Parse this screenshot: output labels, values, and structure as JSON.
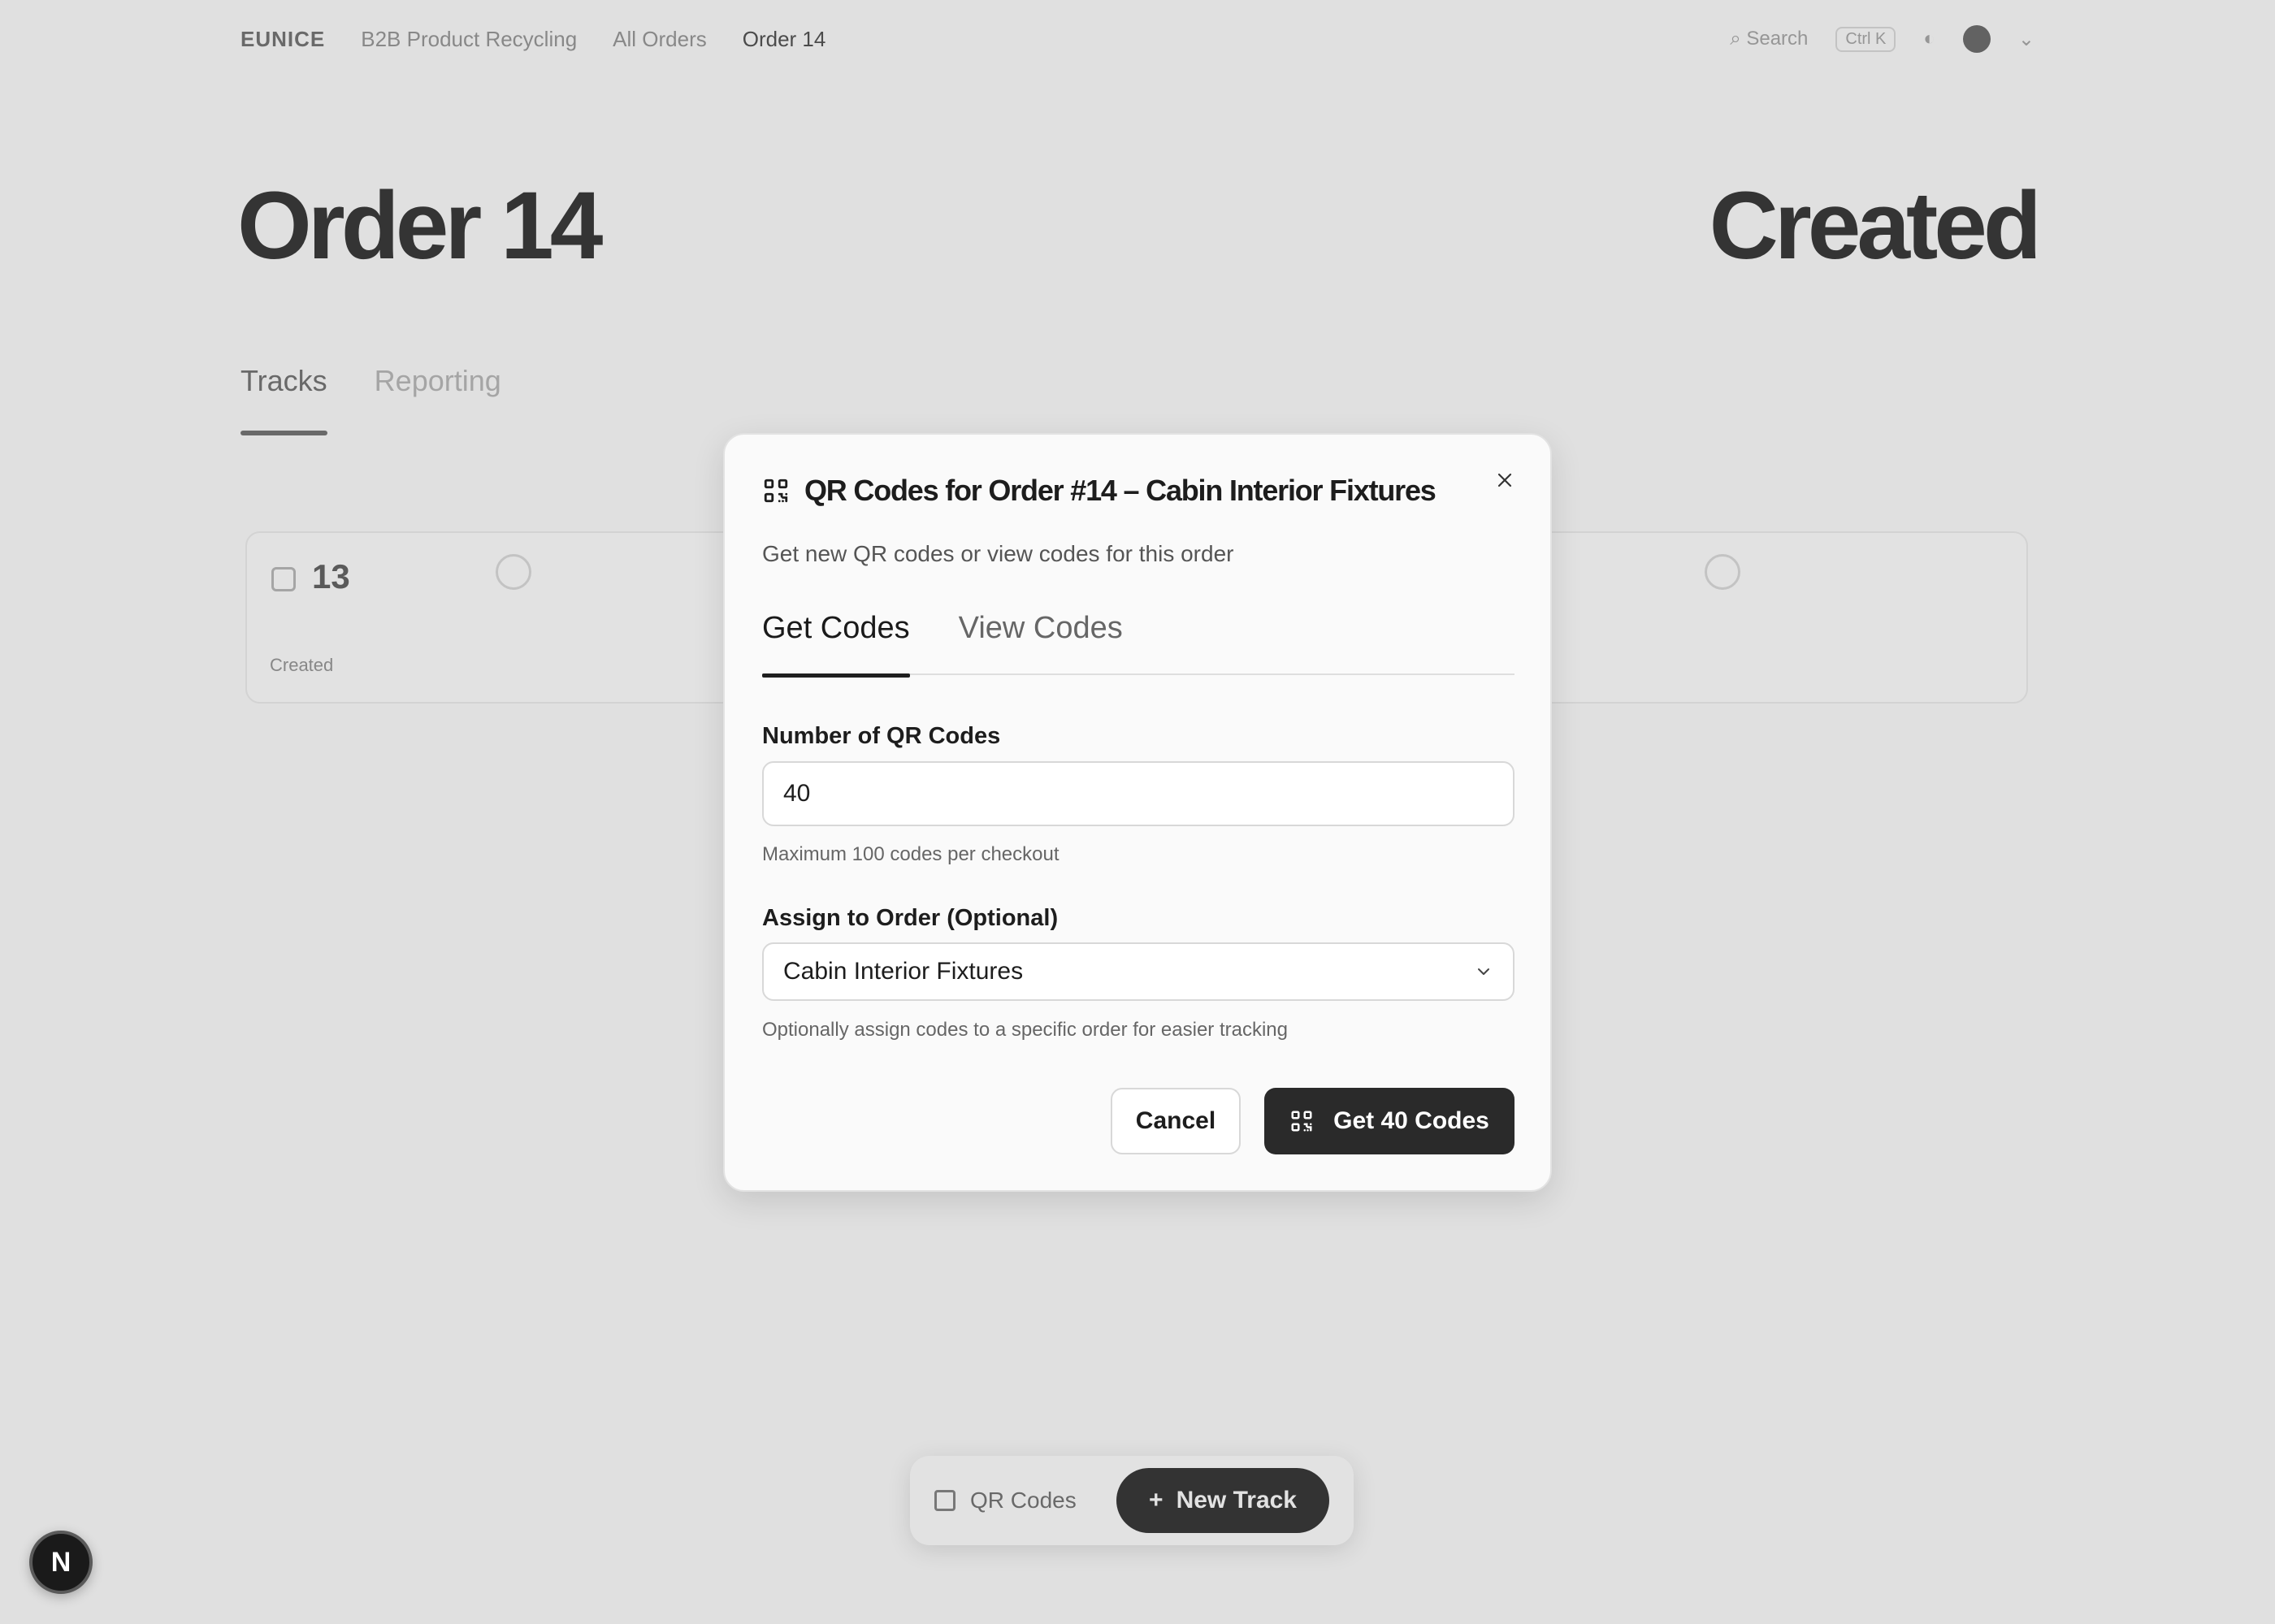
{
  "background": {
    "logo": "EUNICE",
    "breadcrumbs": [
      "B2B Product Recycling",
      "All Orders",
      "Order 14"
    ],
    "search_label": "Search",
    "search_shortcut": "Ctrl K",
    "page_title": "Order 14",
    "order_status": "Created",
    "tabs": [
      "Tracks",
      "Reporting"
    ],
    "stats": {
      "count": "13",
      "label": "Created"
    },
    "bottom_bar": {
      "qr_label": "QR Codes",
      "new_label": "New Track"
    }
  },
  "dialog": {
    "title": "QR Codes for Order #14 – Cabin Interior Fixtures",
    "description": "Get new QR codes or view codes for this order",
    "tabs": [
      {
        "label": "Get Codes",
        "active": true
      },
      {
        "label": "View Codes",
        "active": false
      }
    ],
    "count_field": {
      "label": "Number of QR Codes",
      "value": "40",
      "hint": "Maximum 100 codes per checkout"
    },
    "order_field": {
      "label": "Assign to Order (Optional)",
      "selected": "Cabin Interior Fixtures",
      "hint": "Optionally assign codes to a specific order for easier tracking"
    },
    "cancel_label": "Cancel",
    "submit_label": "Get 40 Codes"
  },
  "dev_badge": "N",
  "colors": {
    "primary_button": "#2a2a2a",
    "overlay": "rgba(0,0,0,0.115)",
    "dialog_bg": "#fafafa"
  }
}
